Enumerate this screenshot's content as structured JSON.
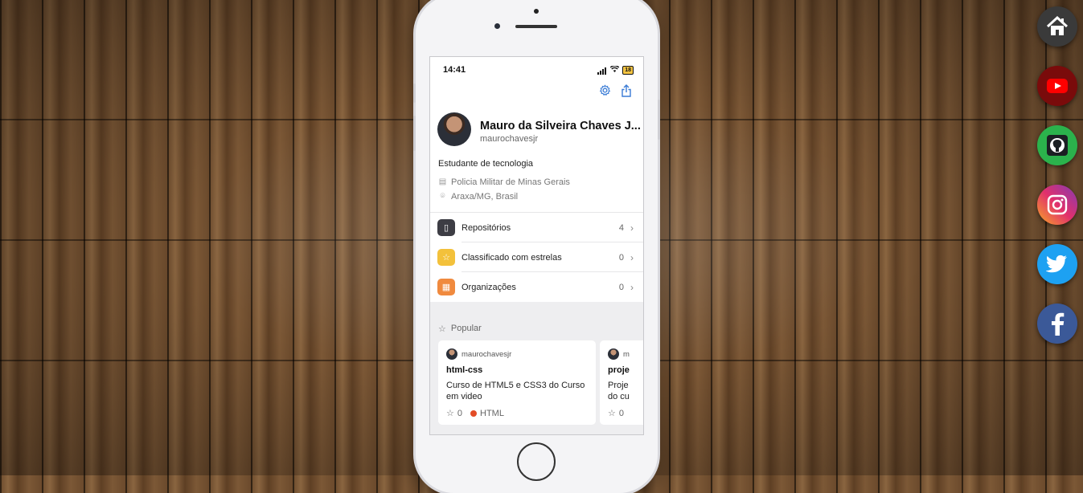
{
  "status": {
    "time": "14:41",
    "battery": "18"
  },
  "profile": {
    "name": "Mauro da Silveira Chaves J...",
    "username": "maurochavesjr",
    "bio": "Estudante de tecnologia",
    "company": "Policia Militar de Minas Gerais",
    "location": "Araxa/MG, Brasil"
  },
  "icons": {
    "settings": "gear-icon",
    "share": "share-icon",
    "company": "building-icon",
    "location": "location-pin-icon",
    "star": "star-icon"
  },
  "menu": [
    {
      "label": "Repositórios",
      "count": "4",
      "color": "#3d3d44",
      "icon": "repo-icon"
    },
    {
      "label": "Classificado com estrelas",
      "count": "0",
      "color": "#f3c13b",
      "icon": "star-icon"
    },
    {
      "label": "Organizações",
      "count": "0",
      "color": "#f08a3e",
      "icon": "organization-icon"
    }
  ],
  "popular": {
    "title": "Popular",
    "cards": [
      {
        "owner": "maurochavesjr",
        "name": "html-css",
        "description": "Curso de HTML5 e CSS3 do Curso em video",
        "stars": "0",
        "language": "HTML",
        "language_color": "#e34c26"
      },
      {
        "owner": "m",
        "name": "proje",
        "description": "Proje do cu",
        "stars": "0"
      }
    ]
  },
  "social": [
    {
      "name": "home",
      "color": "#3a3a3a"
    },
    {
      "name": "youtube",
      "color": "#7a0b0b"
    },
    {
      "name": "github",
      "color": "#2bb24c"
    },
    {
      "name": "instagram",
      "color": "#c13584"
    },
    {
      "name": "twitter",
      "color": "#1da1f2"
    },
    {
      "name": "facebook",
      "color": "#3b5998"
    }
  ]
}
